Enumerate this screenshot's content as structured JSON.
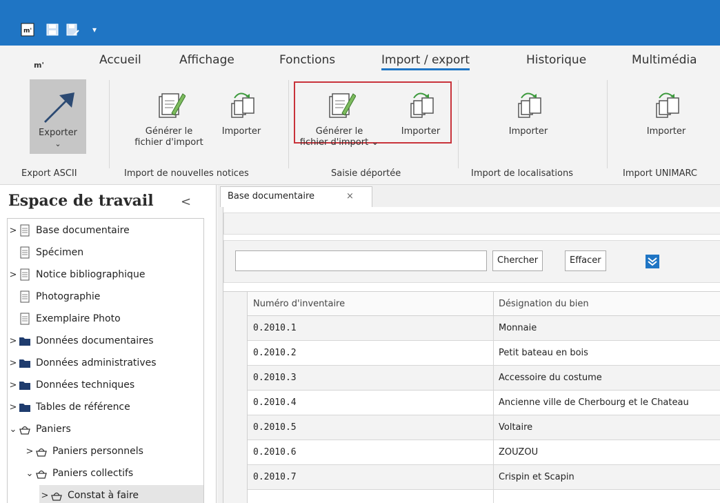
{
  "quick_access": {
    "logo_text": "m'",
    "dropdown_glyph": "▾"
  },
  "ribbon_tabs": {
    "logo_text": "m'",
    "items": [
      "Accueil",
      "Affichage",
      "Fonctions",
      "Import / export",
      "Historique",
      "Multimédia"
    ],
    "active": "Import / export"
  },
  "ribbon": {
    "export": {
      "label": "Exporter",
      "arrow": "⌄"
    },
    "gen1": {
      "line1": "Générer le",
      "line2": "fichier d'import"
    },
    "imp1": {
      "label": "Importer"
    },
    "gen2": {
      "line1": "Générer le",
      "line2": "fichier d'import ⌄"
    },
    "imp2": {
      "label": "Importer"
    },
    "imp3": {
      "label": "Importer"
    },
    "imp4": {
      "label": "Importer"
    },
    "groups": [
      "Export ASCII",
      "Import de nouvelles notices",
      "Saisie déportée",
      "Import de localisations",
      "Import UNIMARC"
    ],
    "highlight_color": "#c8323a"
  },
  "workspace": {
    "title": "Espace de travail",
    "collapse_glyph": "<",
    "tree": [
      {
        "label": "Base documentaire",
        "icon": "document-icon",
        "chevron": ">"
      },
      {
        "label": "Spécimen",
        "icon": "document-icon",
        "chevron": ""
      },
      {
        "label": "Notice bibliographique",
        "icon": "document-icon",
        "chevron": ">"
      },
      {
        "label": "Photographie",
        "icon": "document-icon",
        "chevron": ""
      },
      {
        "label": "Exemplaire Photo",
        "icon": "document-icon",
        "chevron": ""
      },
      {
        "label": "Données documentaires",
        "icon": "folder-icon",
        "chevron": ">"
      },
      {
        "label": "Données administratives",
        "icon": "folder-icon",
        "chevron": ">"
      },
      {
        "label": "Données techniques",
        "icon": "folder-icon",
        "chevron": ">"
      },
      {
        "label": "Tables de référence",
        "icon": "folder-icon",
        "chevron": ">"
      },
      {
        "label": "Paniers",
        "icon": "basket-icon",
        "chevron": "⌄"
      },
      {
        "label": "Paniers personnels",
        "icon": "basket-icon",
        "chevron": ">"
      },
      {
        "label": "Paniers collectifs",
        "icon": "basket-icon",
        "chevron": "⌄"
      },
      {
        "label": "Constat à faire",
        "icon": "basket-icon",
        "chevron": ">"
      }
    ]
  },
  "document_tab": {
    "label": "Base documentaire",
    "close": "×"
  },
  "search": {
    "value": "",
    "search_button": "Chercher",
    "clear_button": "Effacer"
  },
  "grid": {
    "columns": [
      "Numéro d'inventaire",
      "Désignation du bien"
    ],
    "rows": [
      [
        "0.2010.1",
        "Monnaie"
      ],
      [
        "0.2010.2",
        "Petit bateau en bois"
      ],
      [
        "0.2010.3",
        "Accessoire du costume"
      ],
      [
        "0.2010.4",
        "Ancienne ville de Cherbourg et le Chateau"
      ],
      [
        "0.2010.5",
        "Voltaire"
      ],
      [
        "0.2010.6",
        "ZOUZOU"
      ],
      [
        "0.2010.7",
        "Crispin et Scapin"
      ]
    ]
  },
  "colors": {
    "brand": "#1f75c4",
    "folder": "#1f3c6e",
    "export_arrow": "#2c4a73",
    "import_arrow": "#3d9a3d"
  }
}
